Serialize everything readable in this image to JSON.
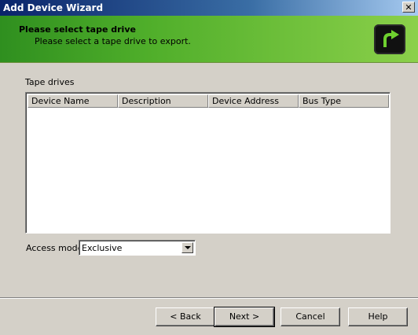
{
  "window": {
    "title": "Add Device Wizard",
    "close_label": "✕"
  },
  "header": {
    "title": "Please select tape drive",
    "subtitle": "Please select a tape drive to export."
  },
  "tape_drives": {
    "label": "Tape drives",
    "columns": [
      "Device Name",
      "Description",
      "Device Address",
      "Bus Type"
    ],
    "rows": []
  },
  "access_mode": {
    "label": "Access mode",
    "value": "Exclusive"
  },
  "buttons": {
    "back": "< Back",
    "next": "Next >",
    "cancel": "Cancel",
    "help": "Help"
  }
}
